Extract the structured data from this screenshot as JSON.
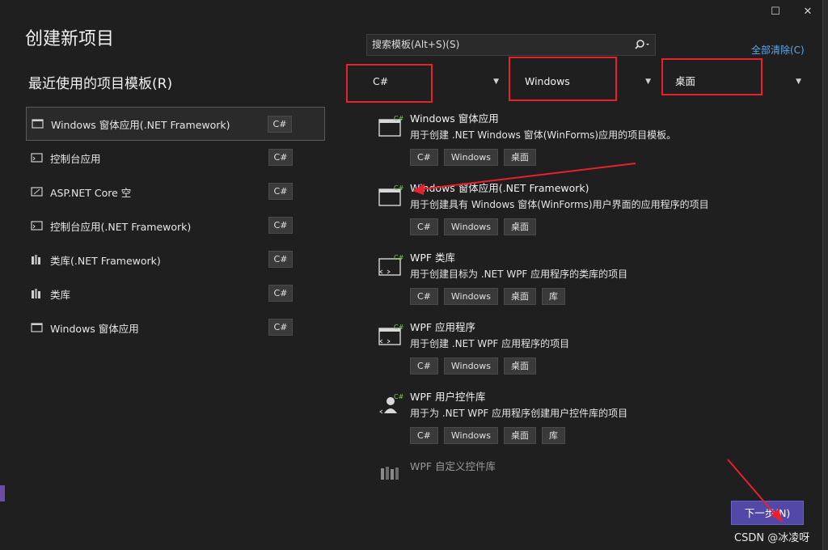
{
  "window": {
    "title": "创建新项目",
    "maximize_glyph": "☐",
    "close_glyph": "✕"
  },
  "recent": {
    "heading": "最近使用的项目模板(R)",
    "items": [
      {
        "label": "Windows 窗体应用(.NET Framework)",
        "tag": "C#",
        "icon": "winforms-icon",
        "selected": true
      },
      {
        "label": "控制台应用",
        "tag": "C#",
        "icon": "console-icon"
      },
      {
        "label": "ASP.NET Core 空",
        "tag": "C#",
        "icon": "web-icon"
      },
      {
        "label": "控制台应用(.NET Framework)",
        "tag": "C#",
        "icon": "console-icon"
      },
      {
        "label": "类库(.NET Framework)",
        "tag": "C#",
        "icon": "library-icon"
      },
      {
        "label": "类库",
        "tag": "C#",
        "icon": "library-icon"
      },
      {
        "label": "Windows 窗体应用",
        "tag": "C#",
        "icon": "winforms-icon"
      }
    ]
  },
  "search": {
    "placeholder": "搜索模板(Alt+S)(S)",
    "icon": "search-icon"
  },
  "clear_all": "全部清除(C)",
  "filters": {
    "language": "C#",
    "platform": "Windows",
    "project_type": "桌面"
  },
  "templates": [
    {
      "name": "Windows 窗体应用",
      "desc": "用于创建 .NET Windows 窗体(WinForms)应用的项目模板。",
      "tags": [
        "C#",
        "Windows",
        "桌面"
      ]
    },
    {
      "name": "Windows 窗体应用(.NET Framework)",
      "desc": "用于创建具有 Windows 窗体(WinForms)用户界面的应用程序的项目",
      "tags": [
        "C#",
        "Windows",
        "桌面"
      ]
    },
    {
      "name": "WPF 类库",
      "desc": "用于创建目标为 .NET WPF 应用程序的类库的项目",
      "tags": [
        "C#",
        "Windows",
        "桌面",
        "库"
      ]
    },
    {
      "name": "WPF 应用程序",
      "desc": "用于创建 .NET WPF 应用程序的项目",
      "tags": [
        "C#",
        "Windows",
        "桌面"
      ]
    },
    {
      "name": "WPF 用户控件库",
      "desc": "用于为 .NET WPF 应用程序创建用户控件库的项目",
      "tags": [
        "C#",
        "Windows",
        "桌面",
        "库"
      ]
    },
    {
      "name": "WPF 自定义控件库",
      "desc": "",
      "tags": []
    }
  ],
  "next_button": "下一步(N)",
  "watermark": "CSDN @冰凌呀",
  "colors": {
    "annotation_red": "#e8212c",
    "primary_button": "#5248a8",
    "link": "#5fa7e8",
    "csharp_badge": "#3c9a3c"
  }
}
